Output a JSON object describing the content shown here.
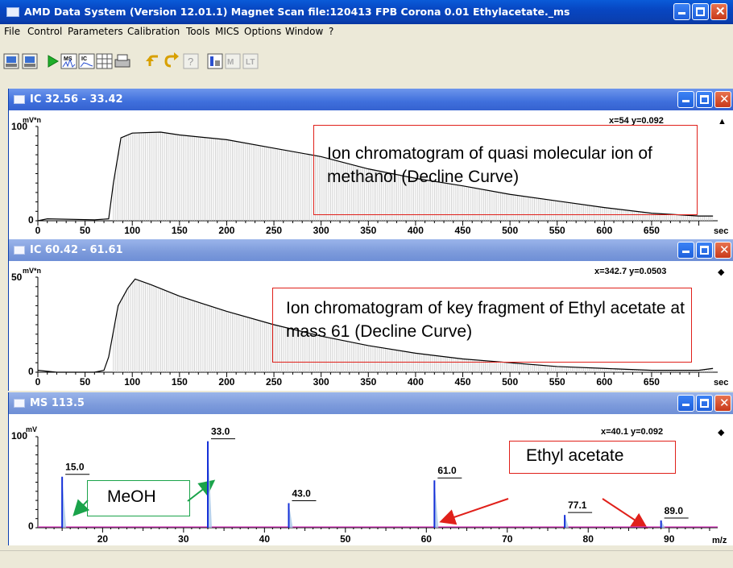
{
  "window": {
    "title": "AMD Data System (Version 12.01.1)   Magnet Scan   file:120413 FPB Corona 0.01 Ethylacetate._ms"
  },
  "menu": [
    "File",
    "Control",
    "Parameters",
    "Calibration",
    "Tools",
    "MICS",
    "Options",
    "Window",
    "?"
  ],
  "toolbar": {
    "icons": [
      "open-icon",
      "save-icon",
      "run-icon",
      "ms-spectrum-icon",
      "ic-chromatogram-icon",
      "table-icon",
      "print-icon",
      "undo-icon",
      "redo-icon",
      "help-icon",
      "view-icon",
      "mark-icon",
      "library-icon"
    ],
    "labels": {
      "ms": "MS",
      "ic": "IC"
    }
  },
  "panels": [
    {
      "title": "IC  32.56 - 33.42",
      "y_top_label": "100",
      "y_zero_label": "0",
      "unit": "mV*n",
      "readout": "x=54  y=0.092",
      "marker": "▲",
      "x_unit": "sec",
      "annotation": "Ion chromatogram of quasi molecular ion of methanol (Decline Curve)"
    },
    {
      "title": "IC  60.42 - 61.61",
      "y_top_label": "50",
      "y_zero_label": "0",
      "unit": "mV*n",
      "readout": "x=342.7  y=0.0503",
      "marker": "◆",
      "x_unit": "sec",
      "annotation": "Ion chromatogram of key fragment of Ethyl acetate at mass 61 (Decline Curve)"
    },
    {
      "title": "MS  113.5",
      "y_top_label": "100",
      "y_zero_label": "0",
      "unit": "mV",
      "readout": "x=40.1  y=0.092",
      "marker": "◆",
      "x_unit": "m/z",
      "annotation_meoh": "MeOH",
      "annotation_ea": "Ethyl acetate"
    }
  ],
  "chart_data": [
    {
      "type": "line",
      "title": "IC  32.56 - 33.42",
      "xlabel": "sec",
      "ylabel": "mV*n",
      "xlim": [
        0,
        720
      ],
      "ylim": [
        0,
        100
      ],
      "x_ticks": [
        0,
        50,
        100,
        150,
        200,
        250,
        300,
        350,
        400,
        450,
        500,
        550,
        600,
        650
      ],
      "series": [
        {
          "x": [
            0,
            10,
            60,
            75,
            80,
            88,
            100,
            130,
            150,
            200,
            250,
            300,
            350,
            400,
            450,
            500,
            550,
            600,
            650,
            700,
            715
          ],
          "y": [
            0,
            2,
            1,
            2,
            40,
            88,
            93,
            94,
            91,
            86,
            77,
            68,
            55,
            45,
            37,
            28,
            21,
            14,
            8,
            5,
            5
          ]
        }
      ]
    },
    {
      "type": "line",
      "title": "IC  60.42 - 61.61",
      "xlabel": "sec",
      "ylabel": "mV*n",
      "xlim": [
        0,
        720
      ],
      "ylim": [
        0,
        50
      ],
      "x_ticks": [
        0,
        50,
        100,
        150,
        200,
        250,
        300,
        350,
        400,
        450,
        500,
        550,
        600,
        650
      ],
      "series": [
        {
          "x": [
            0,
            20,
            60,
            70,
            75,
            85,
            95,
            103,
            120,
            150,
            200,
            250,
            300,
            350,
            400,
            450,
            500,
            550,
            600,
            650,
            700,
            715
          ],
          "y": [
            1,
            0,
            0,
            1,
            8,
            35,
            44,
            49,
            46,
            40,
            32,
            25,
            19,
            14,
            10,
            7,
            5,
            3,
            2,
            1,
            1,
            2
          ]
        }
      ]
    },
    {
      "type": "bar",
      "title": "MS  113.5",
      "xlabel": "m/z",
      "ylabel": "mV",
      "xlim": [
        12,
        96
      ],
      "ylim": [
        0,
        100
      ],
      "x_ticks": [
        20,
        30,
        40,
        50,
        60,
        70,
        80,
        90
      ],
      "peaks": [
        {
          "mz": 15.0,
          "value": 56,
          "label": "15.0"
        },
        {
          "mz": 33.0,
          "value": 95,
          "label": "33.0"
        },
        {
          "mz": 43.0,
          "value": 27,
          "label": "43.0"
        },
        {
          "mz": 61.0,
          "value": 52,
          "label": "61.0"
        },
        {
          "mz": 77.1,
          "value": 14,
          "label": "77.1"
        },
        {
          "mz": 89.0,
          "value": 8,
          "label": "89.0"
        }
      ]
    }
  ]
}
